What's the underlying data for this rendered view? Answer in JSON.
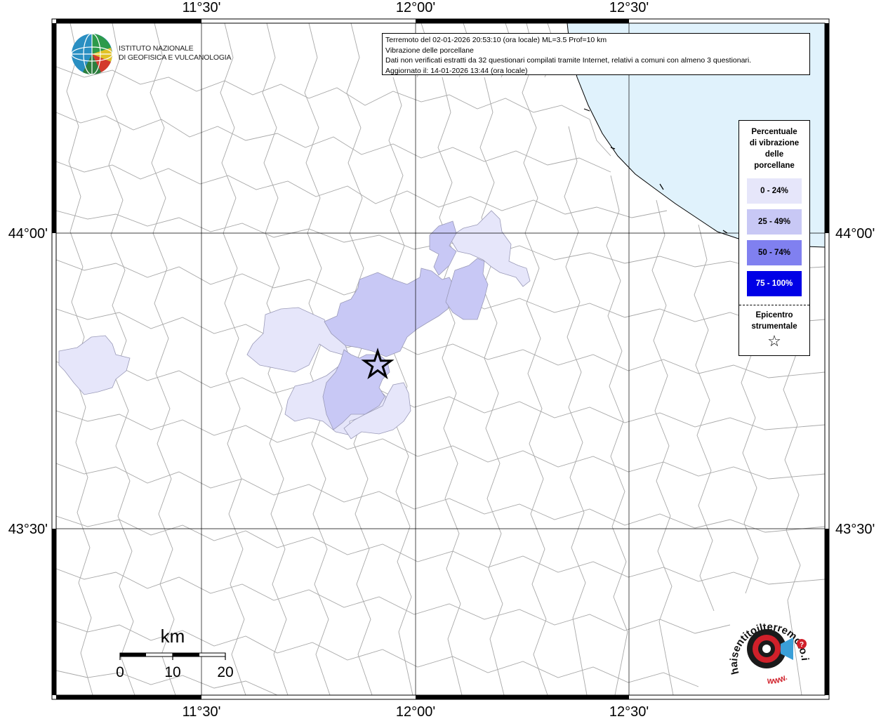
{
  "info": {
    "line1": "Terremoto del 02-01-2026 20:53:10 (ora locale) ML=3.5 Prof=10 km",
    "line2": "Vibrazione delle porcellane",
    "line3": "Dati non verificati estratti da 32 questionari compilati tramite Internet, relativi a comuni con almeno 3 questionari.",
    "line4": "Aggiornato il: 14-01-2026 13:44 (ora locale)"
  },
  "axes": {
    "lon_top": [
      "11°30'",
      "12°00'",
      "12°30'"
    ],
    "lon_bottom": [
      "11°30'",
      "12°00'",
      "12°30'"
    ],
    "lat_left": [
      "44°00'",
      "43°30'"
    ],
    "lat_right": [
      "44°00'",
      "43°30'"
    ]
  },
  "legend": {
    "title_lines": [
      "Percentuale",
      "di vibrazione",
      "delle",
      "porcellane"
    ],
    "classes": [
      {
        "label": "0 - 24%",
        "color": "#e6e6fa",
        "text_color": "#000000"
      },
      {
        "label": "25 - 49%",
        "color": "#c8c8f5",
        "text_color": "#000000"
      },
      {
        "label": "50 - 74%",
        "color": "#8080f0",
        "text_color": "#000000"
      },
      {
        "label": "75 - 100%",
        "color": "#0000e6",
        "text_color": "#ffffff"
      }
    ],
    "epicenter_lines": [
      "Epicentro",
      "strumentale"
    ],
    "epicenter_symbol": "☆"
  },
  "scale_bar": {
    "unit": "km",
    "ticks": [
      "0",
      "10",
      "20"
    ]
  },
  "logos": {
    "ingv_line1": "ISTITUTO NAZIONALE",
    "ingv_line2": "DI GEOFISICA E VULCANOLOGIA",
    "hst_text": "haisentitoilterremoto.it",
    "hst_url": "WWW."
  },
  "colors": {
    "sea": "#e0f2fc",
    "border_gray": "#a8a8a8",
    "grid": "#000000"
  }
}
